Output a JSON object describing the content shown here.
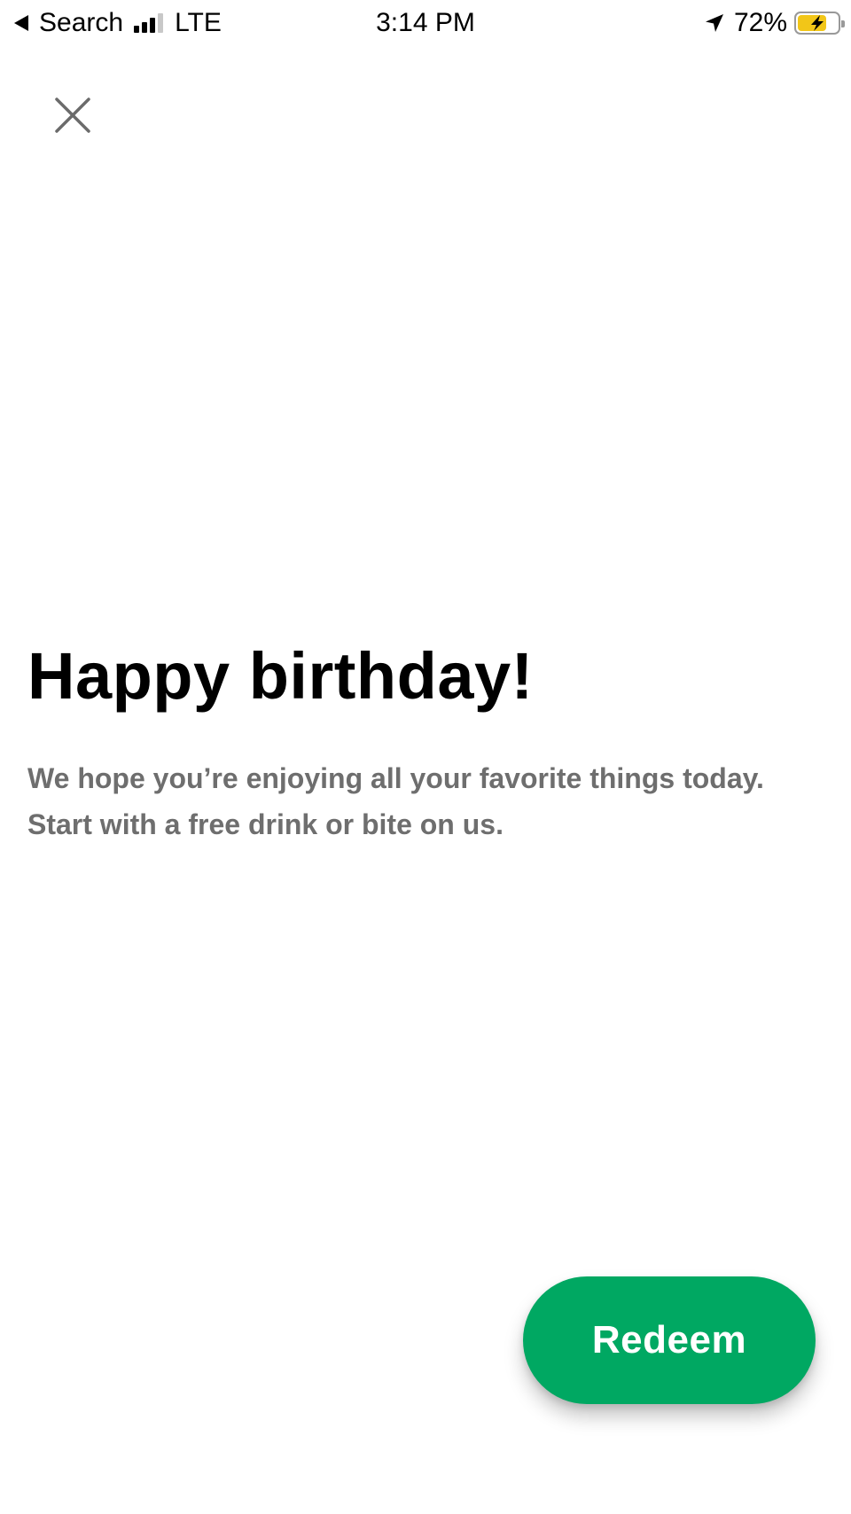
{
  "status_bar": {
    "back_label": "Search",
    "network": "LTE",
    "time": "3:14 PM",
    "battery_percent": "72%",
    "battery_level": 0.72,
    "battery_color": "#f2c618",
    "signal_bars_active": 3,
    "signal_bars_total": 4
  },
  "close": {
    "icon": "close-icon"
  },
  "content": {
    "title": "Happy birthday!",
    "message_line1": "We hope you’re enjoying all your favorite things today.",
    "message_line2": "Start with a free drink or bite on us."
  },
  "actions": {
    "redeem_label": "Redeem",
    "redeem_color": "#00a862"
  }
}
